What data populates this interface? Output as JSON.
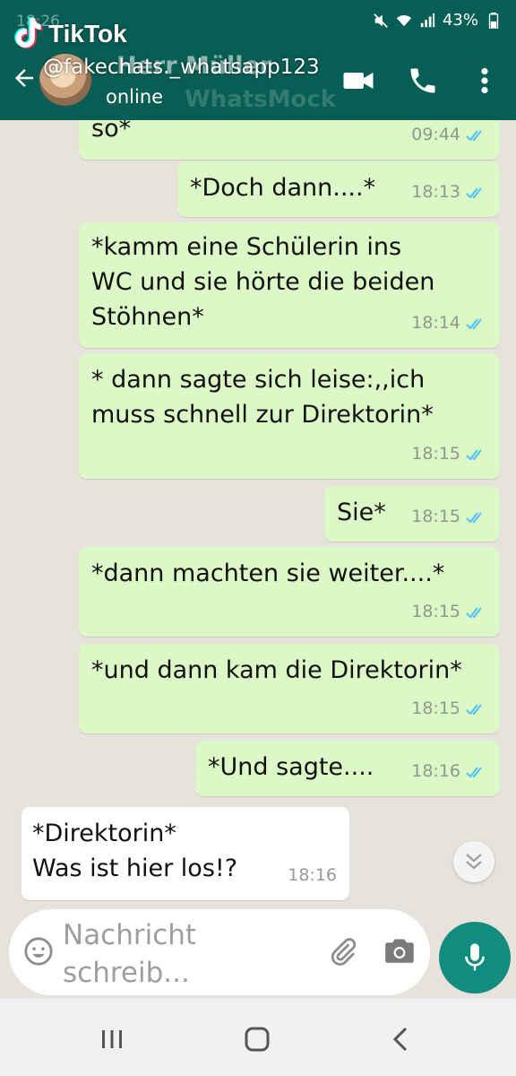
{
  "status_bar": {
    "time": "18:26",
    "battery": "43%"
  },
  "tiktok": {
    "name": "TikTok",
    "handle": "@fakechats._whatsapp123"
  },
  "header": {
    "contact_name": "Herr Müller",
    "contact_status": "online",
    "watermark": "WhatsMock"
  },
  "messages": [
    {
      "text": "so*",
      "time": "09:44"
    },
    {
      "text": "*Doch dann....*",
      "time": "18:13"
    },
    {
      "text": "*kamm eine Schülerin ins\nWC und sie hörte die beiden\nStöhnen*",
      "time": "18:14"
    },
    {
      "text": "* dann sagte sich leise:,,ich\nmuss schnell zur Direktorin*",
      "time": "18:15"
    },
    {
      "text": "Sie*",
      "time": "18:15"
    },
    {
      "text": "*dann machten sie weiter....*",
      "time": "18:15"
    },
    {
      "text": "*und dann kam die Direktorin*",
      "time": "18:15"
    },
    {
      "text": "*Und sagte....",
      "time": "18:16"
    },
    {
      "text": "*Direktorin*\nWas ist hier los!?",
      "time": "18:16"
    }
  ],
  "input": {
    "placeholder": "Nachricht\nschreib..."
  },
  "colors": {
    "header": "#075E54",
    "outgoing": "#dcf8c6",
    "incoming": "#ffffff",
    "accent": "#128C7E",
    "read_tick": "#4fc3f7"
  }
}
